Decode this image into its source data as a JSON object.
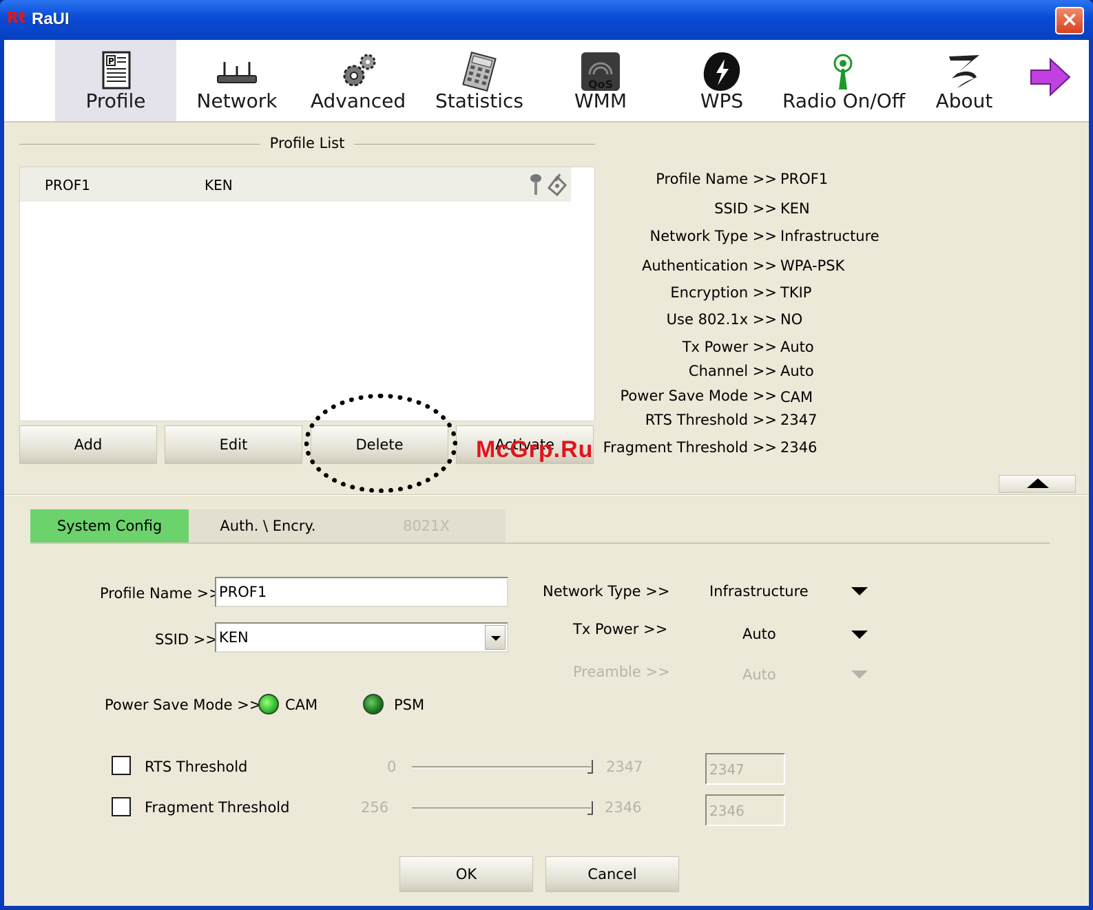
{
  "window": {
    "title": "RaUI",
    "logo": "Rt"
  },
  "toolbar": [
    {
      "label": "Profile",
      "icon": "profile-icon",
      "active": true
    },
    {
      "label": "Network",
      "icon": "network-router-icon"
    },
    {
      "label": "Advanced",
      "icon": "gears-icon"
    },
    {
      "label": "Statistics",
      "icon": "calculator-icon"
    },
    {
      "label": "WMM",
      "icon": "qos-icon"
    },
    {
      "label": "WPS",
      "icon": "wps-icon"
    },
    {
      "label": "Radio On/Off",
      "icon": "antenna-icon"
    },
    {
      "label": "About",
      "icon": "about-logo-icon"
    }
  ],
  "profile_list": {
    "title": "Profile List",
    "rows": [
      {
        "name": "PROF1",
        "ssid": "KEN"
      }
    ]
  },
  "buttons": {
    "add": "Add",
    "edit": "Edit",
    "delete": "Delete",
    "activate": "Activate",
    "ok": "OK",
    "cancel": "Cancel"
  },
  "watermark": "McGrp.Ru",
  "details": [
    {
      "label": "Profile Name >>",
      "value": "PROF1"
    },
    {
      "label": "SSID >>",
      "value": "KEN"
    },
    {
      "label": "Network Type >>",
      "value": "Infrastructure"
    },
    {
      "label": "Authentication >>",
      "value": "WPA-PSK"
    },
    {
      "label": "Encryption >>",
      "value": "TKIP"
    },
    {
      "label": "Use 802.1x >>",
      "value": "NO"
    },
    {
      "label": "Tx Power >>",
      "value": "Auto"
    },
    {
      "label": "Channel >>",
      "value": "Auto"
    },
    {
      "label": "Power Save Mode >>",
      "value": "CAM"
    },
    {
      "label": "RTS Threshold >>",
      "value": "2347"
    },
    {
      "label": "Fragment Threshold >>",
      "value": "2346"
    }
  ],
  "tabs": [
    {
      "label": "System Config",
      "state": "active"
    },
    {
      "label": "Auth. \\ Encry.",
      "state": "normal"
    },
    {
      "label": "8021X",
      "state": "disabled"
    }
  ],
  "config": {
    "profile_name_label": "Profile Name >>",
    "profile_name_value": "PROF1",
    "ssid_label": "SSID >>",
    "ssid_value": "KEN",
    "network_type_label": "Network Type >>",
    "network_type_value": "Infrastructure",
    "tx_power_label": "Tx Power >>",
    "tx_power_value": "Auto",
    "preamble_label": "Preamble >>",
    "preamble_value": "Auto",
    "power_save_label": "Power Save Mode >>",
    "cam_label": "CAM",
    "psm_label": "PSM",
    "rts_label": "RTS Threshold",
    "rts_min": "0",
    "rts_max": "2347",
    "rts_value": "2347",
    "frag_label": "Fragment Threshold",
    "frag_min": "256",
    "frag_max": "2346",
    "frag_value": "2346"
  },
  "colors": {
    "title_bar": "#0a4bd6",
    "active_tab": "#6cd36c",
    "watermark": "#e0141c",
    "window_bg": "#ece9d8"
  }
}
